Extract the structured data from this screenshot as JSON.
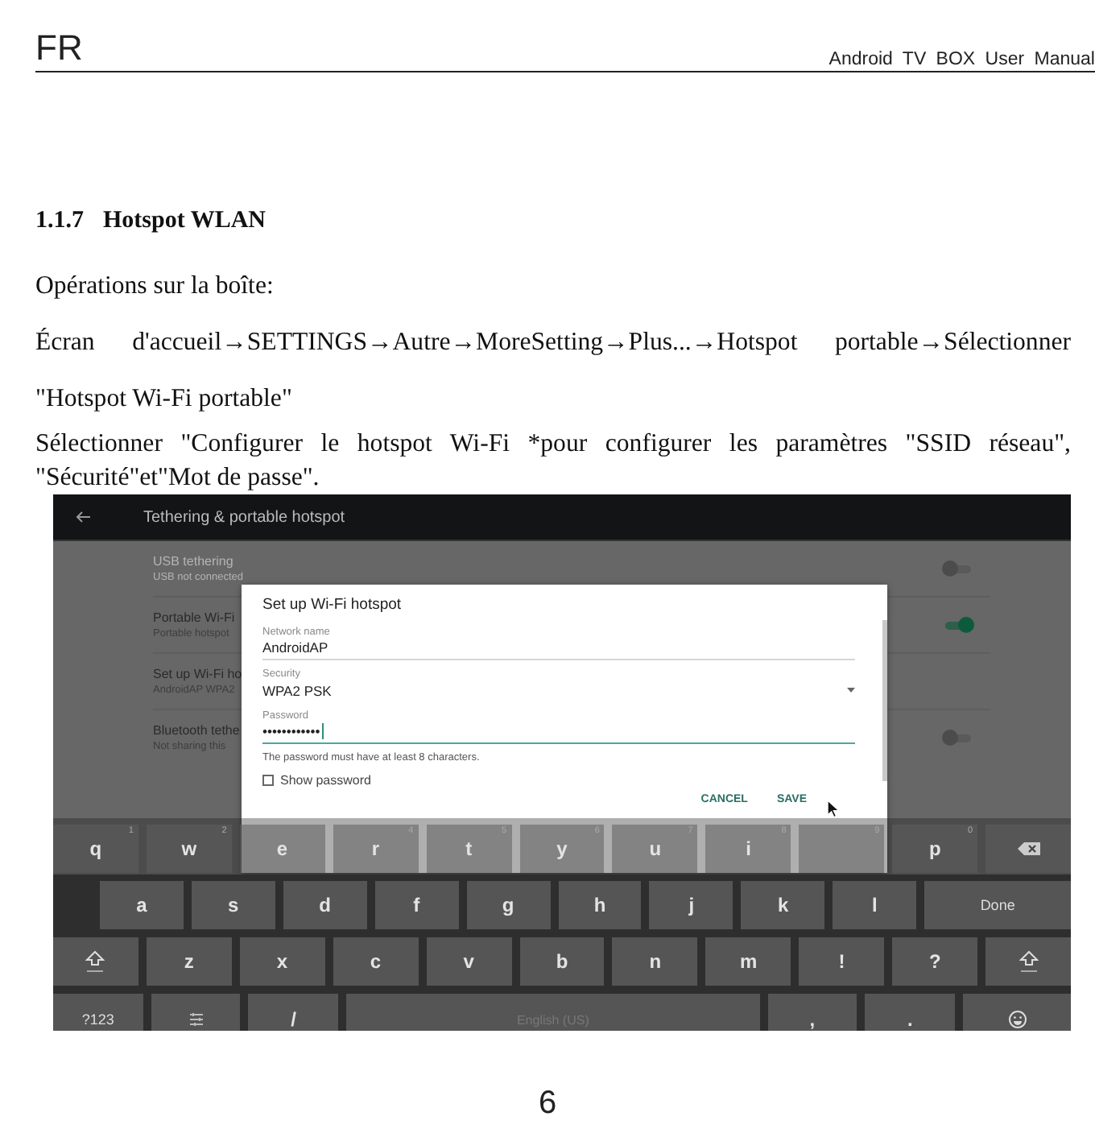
{
  "header": {
    "language": "FR",
    "manual_title": "Android TV BOX User Manual"
  },
  "section": {
    "number": "1.1.7",
    "title": "Hotspot WLAN"
  },
  "paragraphs": [
    "Opérations sur la boîte:",
    "Écran d'accueil→SETTINGS→Autre→MoreSetting→Plus...→Hotspot portable→Sélectionner \"Hotspot Wi-Fi portable\"",
    "Sélectionner \"Configurer le hotspot Wi-Fi *pour configurer les paramètres \"SSID réseau\", \"Sécurité\"et\"Mot de passe\"."
  ],
  "screenshot": {
    "app_bar": {
      "title": "Tethering & portable hotspot"
    },
    "settings": [
      {
        "kind": "toggle",
        "primary": "USB tethering",
        "secondary": "USB not connected",
        "on": false,
        "disabled": true
      },
      {
        "kind": "toggle",
        "primary": "Portable Wi-Fi",
        "secondary": "Portable hotspot",
        "on": true,
        "disabled": false
      },
      {
        "kind": "plain",
        "primary": "Set up Wi-Fi ho",
        "secondary": "AndroidAP WPA2",
        "disabled": false
      },
      {
        "kind": "toggle",
        "primary": "Bluetooth tethe",
        "secondary": "Not sharing this",
        "on": false,
        "disabled": false
      }
    ],
    "dialog": {
      "title": "Set up Wi-Fi hotspot",
      "fields": [
        {
          "kind": "text",
          "label": "Network name",
          "value": "AndroidAP",
          "focused": false
        },
        {
          "kind": "dropdown",
          "label": "Security",
          "value": "WPA2 PSK",
          "focused": false
        },
        {
          "kind": "password",
          "label": "Password",
          "value": "••••••••••••",
          "focused": true
        }
      ],
      "hint": "The password must have at least 8 characters.",
      "show_password": {
        "label": "Show password",
        "checked": false
      },
      "buttons": [
        "CANCEL",
        "SAVE"
      ]
    },
    "keyboard": {
      "rows": [
        {
          "keys": [
            {
              "kind": "char",
              "label": "q",
              "hint": "1"
            },
            {
              "kind": "char",
              "label": "w",
              "hint": "2"
            },
            {
              "kind": "char",
              "label": "e"
            },
            {
              "kind": "char",
              "label": "r",
              "hint": "4"
            },
            {
              "kind": "char",
              "label": "t",
              "hint": "5"
            },
            {
              "kind": "char",
              "label": "y",
              "hint": "6"
            },
            {
              "kind": "char",
              "label": "u",
              "hint": "7"
            },
            {
              "kind": "char",
              "label": "i",
              "hint": "8"
            },
            {
              "kind": "char",
              "hint": "9"
            },
            {
              "kind": "char",
              "label": "p",
              "hint": "0"
            },
            {
              "kind": "backspace"
            }
          ]
        },
        {
          "keys": [
            {
              "kind": "char",
              "label": "a"
            },
            {
              "kind": "char",
              "label": "s"
            },
            {
              "kind": "char",
              "label": "d"
            },
            {
              "kind": "char",
              "label": "f"
            },
            {
              "kind": "char",
              "label": "g"
            },
            {
              "kind": "char",
              "label": "h"
            },
            {
              "kind": "char",
              "label": "j"
            },
            {
              "kind": "char",
              "label": "k"
            },
            {
              "kind": "char",
              "label": "l"
            },
            {
              "kind": "action",
              "label": "Done"
            }
          ]
        },
        {
          "keys": [
            {
              "kind": "shift"
            },
            {
              "kind": "char",
              "label": "z"
            },
            {
              "kind": "char",
              "label": "x"
            },
            {
              "kind": "char",
              "label": "c"
            },
            {
              "kind": "char",
              "label": "v"
            },
            {
              "kind": "char",
              "label": "b"
            },
            {
              "kind": "char",
              "label": "n"
            },
            {
              "kind": "char",
              "label": "m"
            },
            {
              "kind": "char",
              "label": "!"
            },
            {
              "kind": "char",
              "label": "?"
            },
            {
              "kind": "shift"
            }
          ]
        },
        {
          "keys": [
            {
              "kind": "symbols",
              "label": "?123"
            },
            {
              "kind": "settings"
            },
            {
              "kind": "char",
              "label": "/"
            },
            {
              "kind": "space",
              "label": "English (US)"
            },
            {
              "kind": "char",
              "label": ","
            },
            {
              "kind": "char",
              "label": "."
            },
            {
              "kind": "emoji"
            }
          ]
        }
      ]
    }
  },
  "page_number": "6"
}
